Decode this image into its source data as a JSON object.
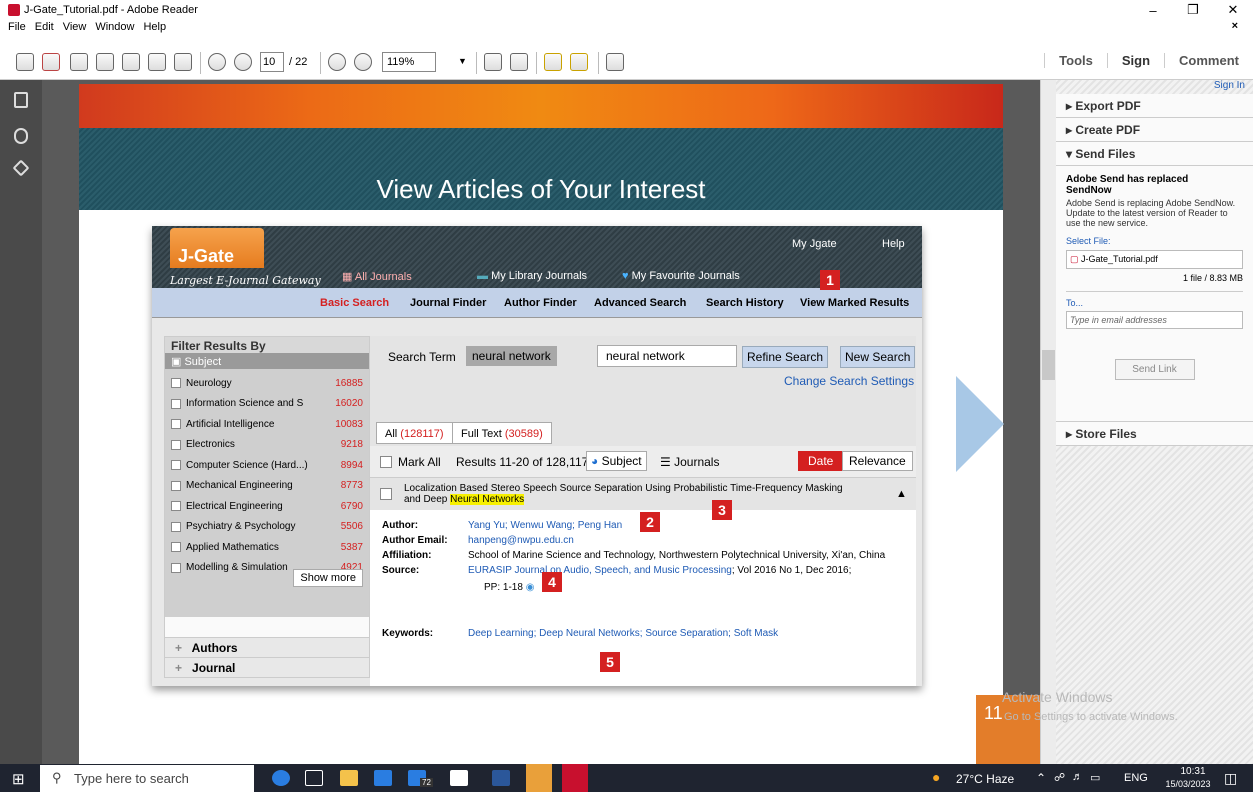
{
  "window": {
    "title": "J-Gate_Tutorial.pdf - Adobe Reader"
  },
  "menu": [
    "File",
    "Edit",
    "View",
    "Window",
    "Help"
  ],
  "toolbar": {
    "page_current": "10",
    "page_total": "/ 22",
    "zoom": "119%"
  },
  "right_tabs": {
    "tools": "Tools",
    "sign": "Sign",
    "comment": "Comment"
  },
  "page": {
    "heading": "View Articles of Your Interest",
    "page_number": "11"
  },
  "jgate": {
    "logo": "J-Gate",
    "tagline": "Largest E-Journal Gateway",
    "top_links": {
      "my_jgate": "My Jgate",
      "help": "Help"
    },
    "tabs": [
      "All Journals",
      "My Library Journals",
      "My Favourite Journals"
    ],
    "subnav": [
      "Basic Search",
      "Journal Finder",
      "Author Finder",
      "Advanced Search",
      "Search History",
      "View Marked Results"
    ],
    "filter": {
      "title": "Filter Results By",
      "subject_header": "Subject",
      "subjects": [
        {
          "name": "Neurology",
          "count": "16885"
        },
        {
          "name": "Information Science and S",
          "count": "16020"
        },
        {
          "name": "Artificial Intelligence",
          "count": "10083"
        },
        {
          "name": "Electronics",
          "count": "9218"
        },
        {
          "name": "Computer Science (Hard...)",
          "count": "8994"
        },
        {
          "name": "Mechanical Engineering",
          "count": "8773"
        },
        {
          "name": "Electrical Engineering",
          "count": "6790"
        },
        {
          "name": "Psychiatry & Psychology",
          "count": "5506"
        },
        {
          "name": "Applied Mathematics",
          "count": "5387"
        },
        {
          "name": "Modelling & Simulation",
          "count": "4921"
        }
      ],
      "show_more": "Show more",
      "authors": "Authors",
      "journal": "Journal"
    },
    "search": {
      "term_label": "Search Term",
      "term_value": "neural network",
      "input_value": "neural network",
      "refine": "Refine Search",
      "new": "New Search",
      "change_settings": "Change Search Settings"
    },
    "result_tabs": {
      "all": "All",
      "all_count": "(128117)",
      "full_text": "Full Text",
      "full_text_count": "(30589)"
    },
    "results_bar": {
      "mark_all": "Mark All",
      "results": "Results 11-20 of 128,117",
      "subject": "Subject",
      "journals": "Journals",
      "date": "Date",
      "relevance": "Relevance"
    },
    "article": {
      "title_line1": "Localization Based Stereo Speech Source Separation Using Probabilistic Time-Frequency Masking",
      "title_line2_prefix": "and Deep ",
      "title_line2_highlight": "Neural Networks",
      "author_label": "Author:",
      "authors": "Yang Yu; Wenwu Wang; Peng Han",
      "email_label": "Author Email:",
      "email": "hanpeng@nwpu.edu.cn",
      "affiliation_label": "Affiliation:",
      "affiliation": "School of Marine Science and Technology, Northwestern Polytechnical University, Xi'an, China",
      "source_label": "Source:",
      "source_journal": "EURASIP Journal on Audio, Speech, and Music Processing",
      "source_rest": "; Vol 2016 No 1, Dec 2016;",
      "pages": "PP: 1-18",
      "keywords_label": "Keywords:",
      "keywords": "Deep Learning; Deep Neural Networks; Source Separation; Soft Mask"
    },
    "markers": [
      "1",
      "2",
      "3",
      "4",
      "5"
    ]
  },
  "right_panel": {
    "sign_in": "Sign In",
    "export_pdf": "Export PDF",
    "create_pdf": "Create PDF",
    "send_files": "Send Files",
    "notice_title": "Adobe Send has replaced SendNow",
    "notice_body": "Adobe Send is replacing Adobe SendNow. Update to the latest version of Reader to use the new service.",
    "select_file": "Select File:",
    "file_name": "J-Gate_Tutorial.pdf",
    "file_size": "1 file / 8.83 MB",
    "to": "To...",
    "email_placeholder": "Type in email addresses",
    "send_link": "Send Link",
    "store_files": "Store Files"
  },
  "watermark": {
    "line1": "Activate Windows",
    "line2": "Go to Settings to activate Windows."
  },
  "taskbar": {
    "search_placeholder": "Type here to search",
    "weather": "27°C  Haze",
    "lang": "ENG",
    "time": "10:31",
    "date": "15/03/2023",
    "badge": "72"
  },
  "colors": {
    "accent_red": "#d42020",
    "link_blue": "#1f5bb5",
    "jgate_orange": "#e67c1f"
  }
}
